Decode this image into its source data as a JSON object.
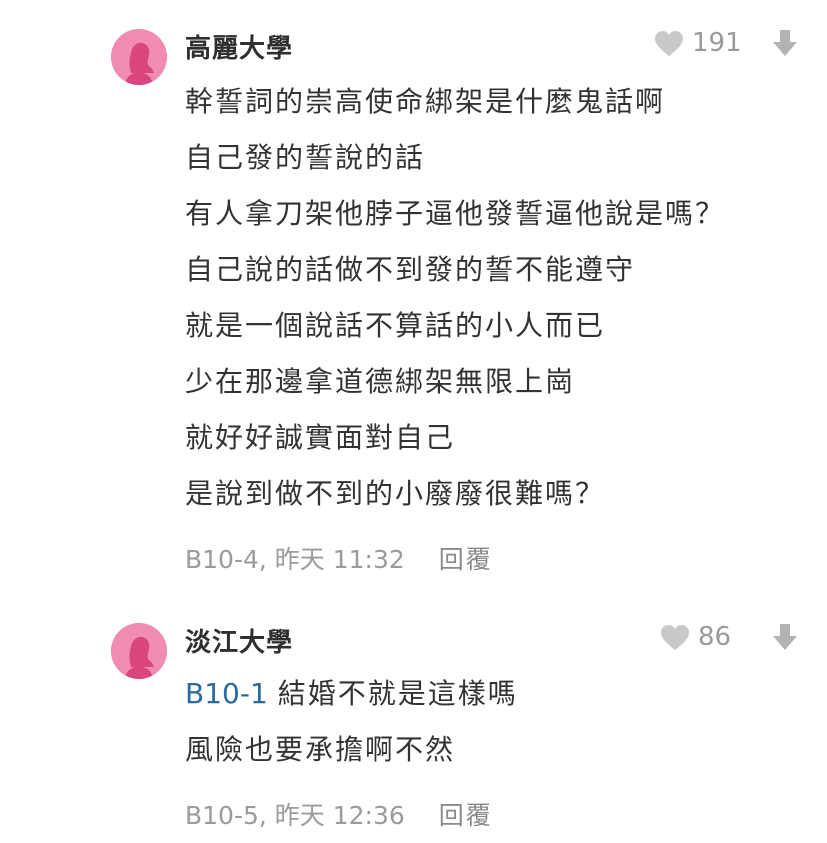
{
  "comments": [
    {
      "author": "高麗大學",
      "likes": "191",
      "reply_to": "",
      "lines": [
        "幹誓詞的崇高使命綁架是什麼鬼話啊",
        "自己發的誓說的話",
        "有人拿刀架他脖子逼他發誓逼他說是嗎？",
        "自己說的話做不到發的誓不能遵守",
        "就是一個說話不算話的小人而已",
        "少在那邊拿道德綁架無限上崗",
        "就好好誠實面對自己",
        "是說到做不到的小廢廢很難嗎？"
      ],
      "floor": "B10-4, 昨天 11:32",
      "reply_label": "回覆"
    },
    {
      "author": "淡江大學",
      "likes": "86",
      "reply_to": "B10-1",
      "first_line_rest": "結婚不就是這樣嗎",
      "lines": [
        "風險也要承擔啊不然"
      ],
      "floor": "B10-5, 昨天 12:36",
      "reply_label": "回覆"
    }
  ],
  "icons": {
    "avatar": "female-avatar-icon",
    "like": "heart-icon",
    "dislike": "thumb-down-arrow-icon"
  },
  "colors": {
    "avatar_bg": "#f08cb1",
    "avatar_fg": "#d9467d",
    "reply_tag": "#2b6a9e",
    "muted": "#9b9b9b"
  }
}
